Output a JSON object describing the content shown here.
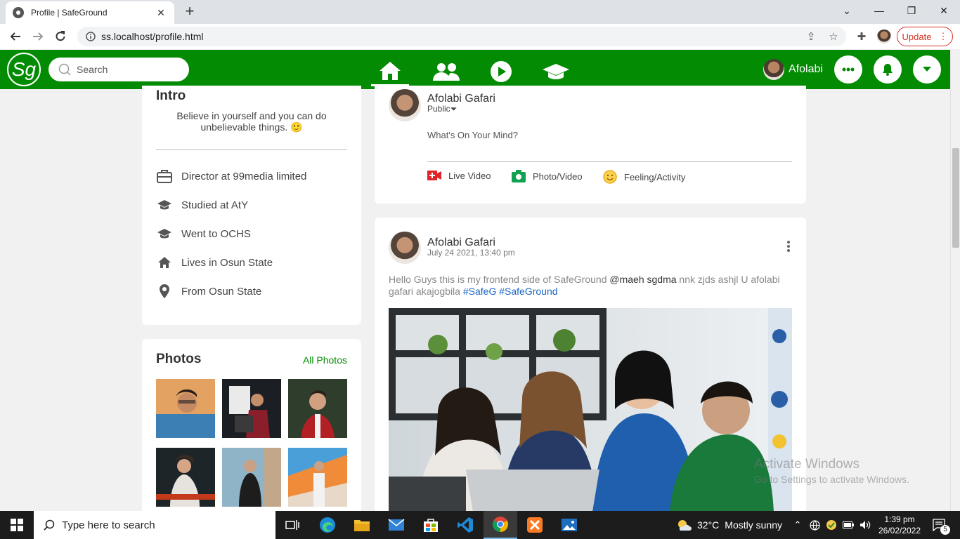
{
  "browser": {
    "tab_title": "Profile | SafeGround",
    "url": "ss.localhost/profile.html",
    "update_label": "Update"
  },
  "header": {
    "logo_text": "Sg",
    "search_placeholder": "Search",
    "user_name": "Afolabi",
    "brand_color": "#038b03"
  },
  "intro": {
    "title": "Intro",
    "bio": "Believe in yourself and you can do unbelievable things. 🙂",
    "items": [
      {
        "icon": "briefcase-icon",
        "label": "Director at 99media limited"
      },
      {
        "icon": "graduation-cap-icon",
        "label": "Studied at AtY"
      },
      {
        "icon": "graduation-cap-icon",
        "label": "Went to OCHS"
      },
      {
        "icon": "home-icon",
        "label": "Lives in Osun State"
      },
      {
        "icon": "location-pin-icon",
        "label": "From Osun State"
      }
    ]
  },
  "photos": {
    "title": "Photos",
    "all_link": "All Photos"
  },
  "composer": {
    "name": "Afolabi Gafari",
    "privacy": "Public",
    "prompt": "What's On Your Mind?",
    "actions": {
      "live": "Live Video",
      "photo": "Photo/Video",
      "feeling": "Feeling/Activity"
    }
  },
  "post": {
    "name": "Afolabi Gafari",
    "date": "July 24 2021, 13:40 pm",
    "text_start": "Hello Guys this is my frontend side of SafeGround ",
    "mention": "@maeh sgdma",
    "text_mid": " nnk zjds ashjl U afolabi gafari akajogbila ",
    "tag1": "#SafeG",
    "tag2": "#SafeGround"
  },
  "watermark": {
    "line1": "Activate Windows",
    "line2": "Go to Settings to activate Windows."
  },
  "taskbar": {
    "search_text": "Type here to search",
    "temperature": "32°C",
    "weather": "Mostly sunny",
    "time": "1:39 pm",
    "date": "26/02/2022",
    "notification_count": "5"
  }
}
